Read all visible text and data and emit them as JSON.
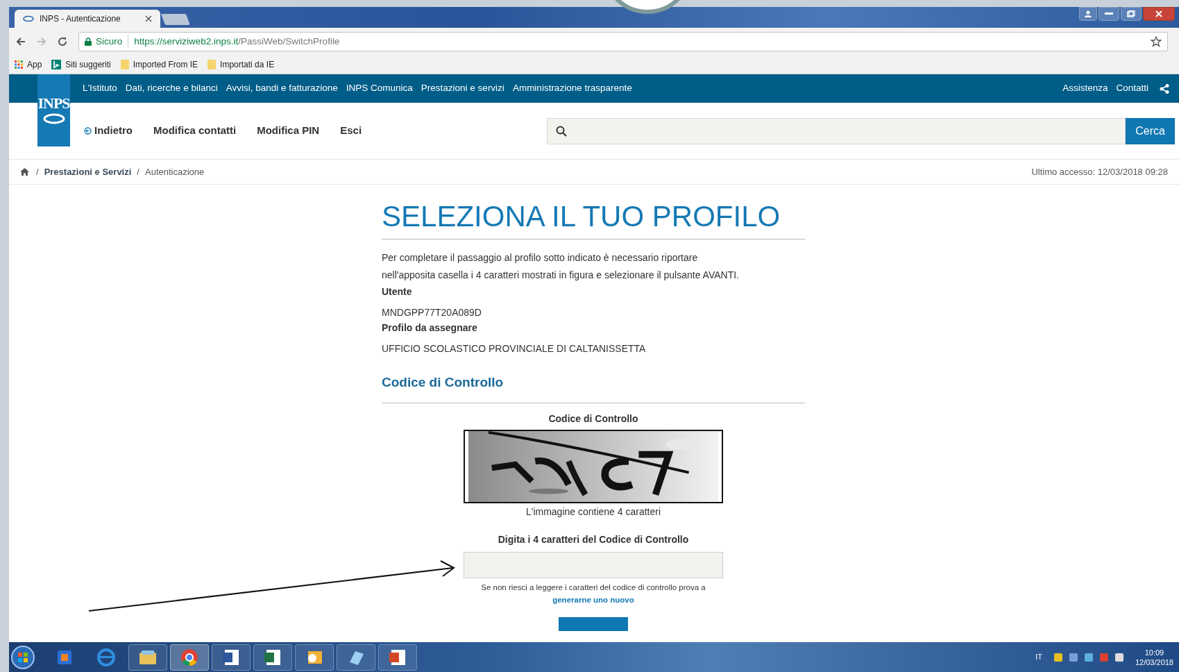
{
  "browser": {
    "tabs": [
      {
        "title": "INPS - Autenticazione",
        "selected": true
      }
    ],
    "address": {
      "secure_label": "Sicuro",
      "host": "https://serviziweb2.inps.it",
      "path": "/PassiWeb/SwitchProfile"
    },
    "bookmarks": [
      {
        "kind": "apps",
        "label": "App"
      },
      {
        "kind": "site",
        "label": "Siti suggeriti"
      },
      {
        "kind": "folder",
        "label": "Imported From IE"
      },
      {
        "kind": "folder",
        "label": "Importati da IE"
      }
    ]
  },
  "site": {
    "logo": "INPS",
    "top_nav": [
      "L'Istituto",
      "Dati, ricerche e bilanci",
      "Avvisi, bandi e fatturazione",
      "INPS Comunica",
      "Prestazioni e servizi",
      "Amministrazione trasparente"
    ],
    "utility_links": [
      "Assistenza",
      "Contatti"
    ],
    "header_nav": [
      {
        "kind": "back",
        "label": "Indietro"
      },
      {
        "kind": "link",
        "label": "Modifica contatti"
      },
      {
        "kind": "link",
        "label": "Modifica PIN"
      },
      {
        "kind": "link",
        "label": "Esci"
      }
    ],
    "search_button": "Cerca",
    "breadcrumb_separator": "/",
    "breadcrumb": [
      {
        "kind": "link",
        "label": "Prestazioni e Servizi"
      },
      {
        "kind": "current",
        "label": "Autenticazione"
      }
    ],
    "last_access": "Ultimo accesso: 12/03/2018 09:28"
  },
  "page": {
    "title": "SELEZIONA IL TUO PROFILO",
    "intro": [
      "Per completare il passaggio al profilo sotto indicato è necessario riportare",
      "nell'apposita casella i 4 caratteri mostrati in figura e selezionare il pulsante AVANTI."
    ],
    "fields": [
      {
        "label": "Utente",
        "value": "MNDGPP77T20A089D"
      },
      {
        "label": "Profilo da assegnare",
        "value": "UFFICIO SCOLASTICO PROVINCIALE DI CALTANISSETTA"
      }
    ],
    "section_heading": "Codice di Controllo",
    "captcha_label": "Codice di Controllo",
    "captcha_caption": "L'immagine contiene 4 caratteri",
    "input_label": "Digita i 4 caratteri del Codice di Controllo",
    "help_text": "Se non riesci a leggere i caratteri del codice di controllo prova a",
    "help_link": "generarne uno nuovo"
  },
  "taskbar": {
    "language": "IT",
    "time": "10:09",
    "date": "12/03/2018"
  }
}
